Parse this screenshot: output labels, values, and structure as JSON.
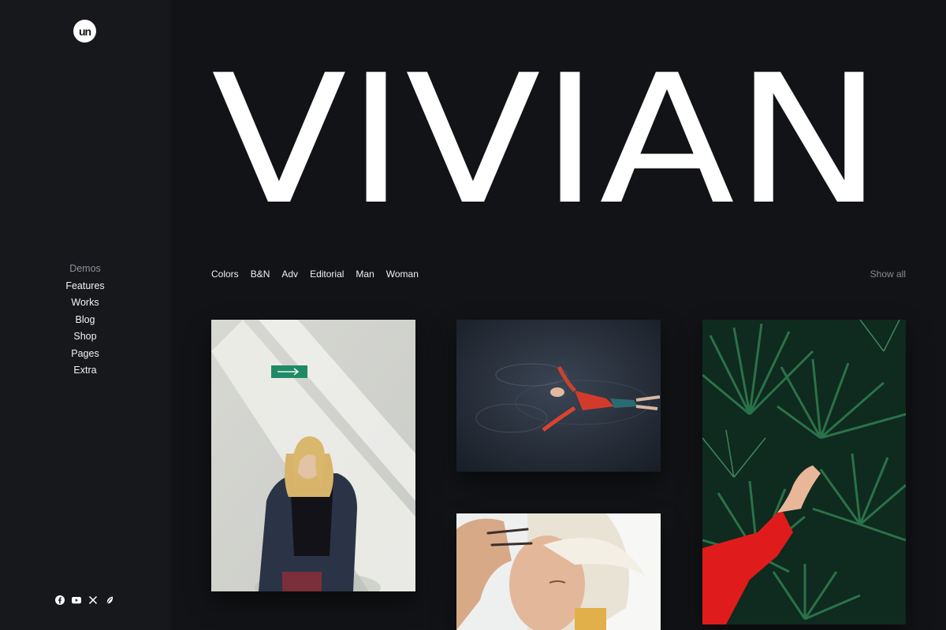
{
  "brand": {
    "logo_text": "un"
  },
  "hero": {
    "title": "VIVIAN"
  },
  "sidebar": {
    "items": [
      {
        "label": "Demos",
        "muted": true
      },
      {
        "label": "Features"
      },
      {
        "label": "Works"
      },
      {
        "label": "Blog"
      },
      {
        "label": "Shop"
      },
      {
        "label": "Pages"
      },
      {
        "label": "Extra"
      }
    ],
    "social": [
      "facebook-icon",
      "youtube-icon",
      "x-icon",
      "leaf-icon"
    ]
  },
  "filters": {
    "items": [
      "Colors",
      "B&N",
      "Adv",
      "Editorial",
      "Man",
      "Woman"
    ],
    "show_all": "Show all"
  },
  "gallery": [
    {
      "name": "photo-woman-jacket-wall",
      "subject": "woman in denim jacket against white wall"
    },
    {
      "name": "photo-woman-floating-water",
      "subject": "woman in red floating on dark water"
    },
    {
      "name": "photo-blonde-portrait",
      "subject": "close-up blonde woman with hand on forehead"
    },
    {
      "name": "photo-palm-leaves-red-sleeve",
      "subject": "palm leaves with hand in red sleeve"
    }
  ],
  "colors": {
    "background": "#121316",
    "sidebar": "#17181c",
    "text": "#ffffff",
    "muted": "#8e9096"
  }
}
